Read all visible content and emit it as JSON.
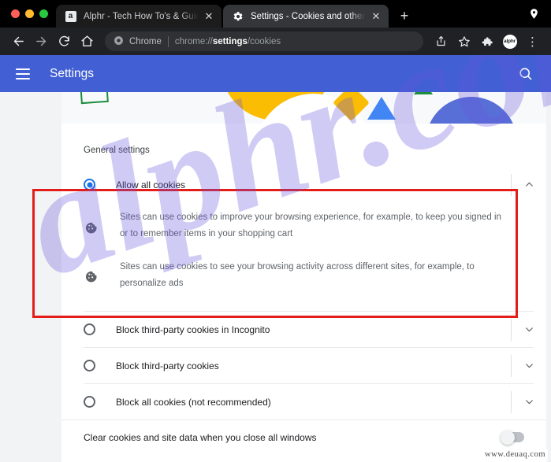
{
  "browser": {
    "window_controls": [
      "close",
      "minimize",
      "zoom"
    ],
    "tabs": [
      {
        "title": "Alphr - Tech How To's & Guides",
        "favicon": "alphr-favicon",
        "active": false,
        "close_label": "✕"
      },
      {
        "title": "Settings - Cookies and other si",
        "favicon": "gear-icon",
        "active": true,
        "close_label": "✕"
      }
    ],
    "new_tab_label": "+",
    "toolbar": {
      "back_label": "←",
      "forward_label": "→",
      "reload_label": "⟳",
      "home_label": "⌂",
      "omnibox_chip": "Chrome",
      "url_prefix": "chrome://",
      "url_bold": "settings",
      "url_suffix": "/cookies",
      "share_label": "share-icon",
      "bookmark_label": "☆",
      "extensions_label": "puzzle-icon",
      "avatar_text": "alphr",
      "menu_label": "⋮"
    }
  },
  "settings_header": {
    "menu_label": "hamburger-menu",
    "title": "Settings",
    "search_label": "search-icon"
  },
  "page": {
    "section_title": "General settings",
    "options": [
      {
        "label": "Allow all cookies",
        "selected": true,
        "expanded": true,
        "chevron": "chevron-up",
        "descriptions": [
          "Sites can use cookies to improve your browsing experience, for example, to keep you signed in or to remember items in your shopping cart",
          "Sites can use cookies to see your browsing activity across different sites, for example, to personalize ads"
        ]
      },
      {
        "label": "Block third-party cookies in Incognito",
        "selected": false,
        "expanded": false,
        "chevron": "chevron-down",
        "descriptions": []
      },
      {
        "label": "Block third-party cookies",
        "selected": false,
        "expanded": false,
        "chevron": "chevron-down",
        "descriptions": []
      },
      {
        "label": "Block all cookies (not recommended)",
        "selected": false,
        "expanded": false,
        "chevron": "chevron-down",
        "descriptions": []
      }
    ],
    "bottom_setting": {
      "label": "Clear cookies and site data when you close all windows",
      "toggle_state": "off"
    }
  },
  "annotations": {
    "highlight_color": "#e31d1a",
    "highlight_target": "Allow all cookies option"
  },
  "watermarks": {
    "large": "alphr.com",
    "small": "www.deuaq.com"
  },
  "colors": {
    "accent_blue": "#1a73e8",
    "settings_bar": "#4260d3",
    "chrome_dark": "#202124",
    "highlight_red": "#e31d1a"
  }
}
